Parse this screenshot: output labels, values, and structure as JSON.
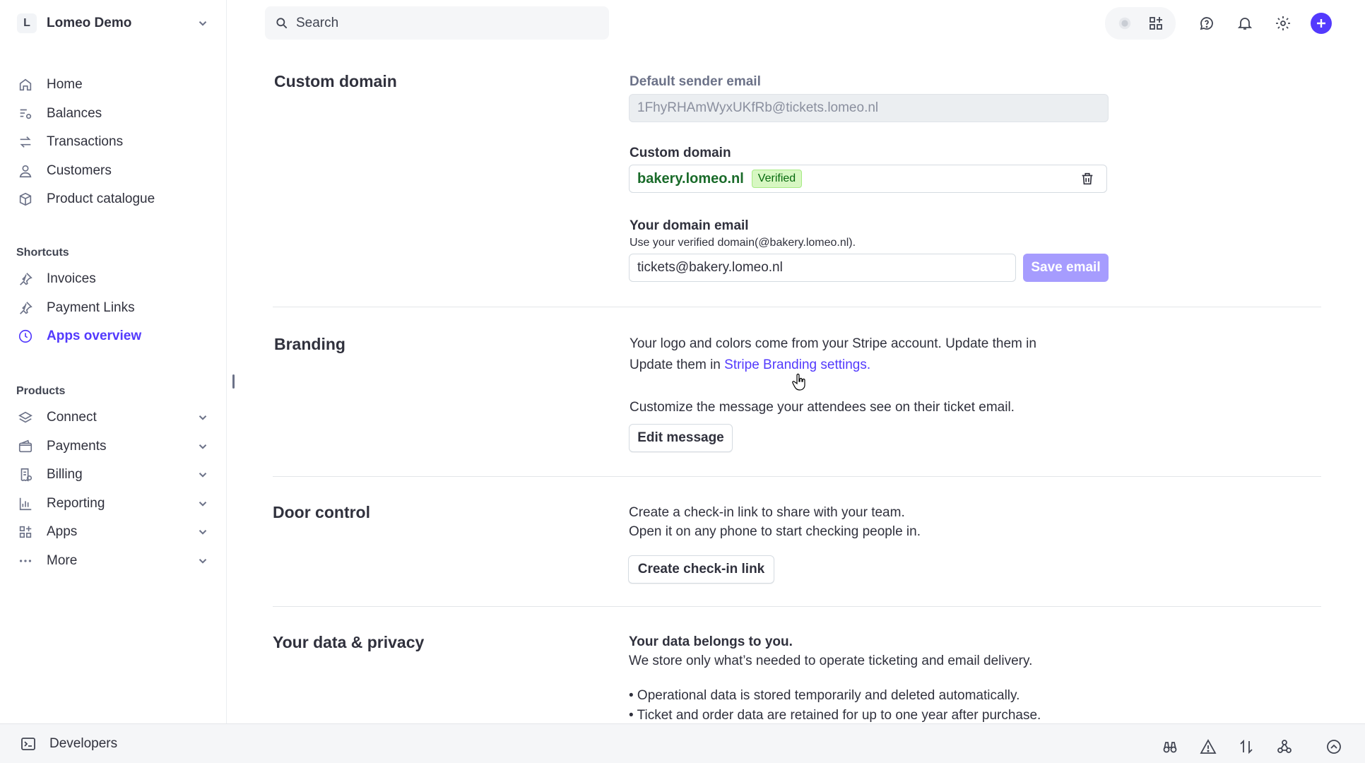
{
  "account": {
    "initial": "L",
    "name": "Lomeo Demo"
  },
  "nav": {
    "main": [
      {
        "label": "Home",
        "icon": "home-icon"
      },
      {
        "label": "Balances",
        "icon": "balances-icon"
      },
      {
        "label": "Transactions",
        "icon": "transactions-icon"
      },
      {
        "label": "Customers",
        "icon": "customers-icon"
      },
      {
        "label": "Product catalogue",
        "icon": "box-icon"
      }
    ],
    "shortcuts_title": "Shortcuts",
    "shortcuts": [
      {
        "label": "Invoices",
        "icon": "pin-icon"
      },
      {
        "label": "Payment Links",
        "icon": "pin-icon"
      },
      {
        "label": "Apps overview",
        "icon": "clock-icon",
        "active": true
      }
    ],
    "products_title": "Products",
    "products": [
      {
        "label": "Connect",
        "icon": "layers-icon"
      },
      {
        "label": "Payments",
        "icon": "wallet-icon"
      },
      {
        "label": "Billing",
        "icon": "billing-icon"
      },
      {
        "label": "Reporting",
        "icon": "chart-icon"
      },
      {
        "label": "Apps",
        "icon": "apps-icon"
      },
      {
        "label": "More",
        "icon": "more-icon"
      }
    ]
  },
  "search": {
    "placeholder": "Search"
  },
  "sections": {
    "custom_domain": {
      "title": "Custom domain",
      "default_sender_label": "Default sender email",
      "default_sender_value": "1FhyRHAmWyxUKfRb@tickets.lomeo.nl",
      "domain_label": "Custom domain",
      "domain_value": "bakery.lomeo.nl",
      "domain_status": "Verified",
      "domain_email_label": "Your domain email",
      "domain_email_hint": "Use your verified domain(@bakery.lomeo.nl).",
      "domain_email_value": "tickets@bakery.lomeo.nl",
      "save_label": "Save email"
    },
    "branding": {
      "title": "Branding",
      "line1": "Your logo and colors come from your Stripe account. Update them in",
      "line2_prefix": "Update them in ",
      "link": "Stripe Branding settings.",
      "customize_text": "Customize the message your attendees see on their ticket email.",
      "edit_label": "Edit message"
    },
    "door_control": {
      "title": "Door control",
      "line1": "Create a check-in link to share with your team.",
      "line2": "Open it on any phone to start checking people in.",
      "button_label": "Create check-in link"
    },
    "privacy": {
      "title": "Your data & privacy",
      "heading": "Your data belongs to you.",
      "line1": "We store only what’s needed to operate ticketing and email delivery.",
      "bullet1": "• Operational data is stored temporarily and deleted automatically.",
      "bullet2": "• Ticket and order data are retained for up to one year after purchase."
    }
  },
  "footer": {
    "developers_label": "Developers"
  },
  "colors": {
    "accent": "#533afd",
    "verified": "#05690d",
    "save_disabled": "#a69cfe"
  }
}
